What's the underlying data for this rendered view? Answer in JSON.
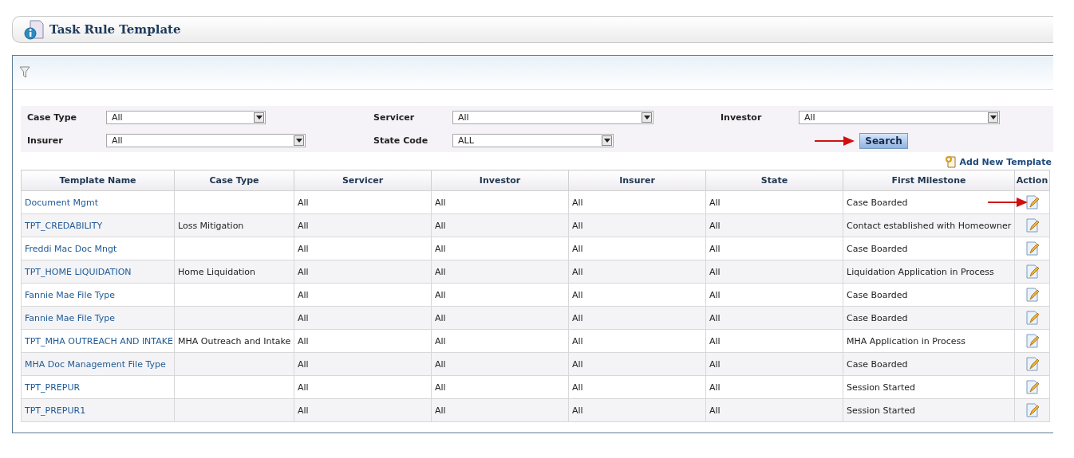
{
  "page": {
    "title": "Task Rule Template"
  },
  "filters": [
    {
      "label": "Case Type",
      "value": "All"
    },
    {
      "label": "Servicer",
      "value": "All"
    },
    {
      "label": "Investor",
      "value": "All"
    },
    {
      "label": "Insurer",
      "value": "All"
    },
    {
      "label": "State Code",
      "value": "ALL"
    }
  ],
  "search_button": "Search",
  "add_link": "Add New Template",
  "table": {
    "columns": [
      "Template Name",
      "Case Type",
      "Servicer",
      "Investor",
      "Insurer",
      "State",
      "First Milestone",
      "Action"
    ],
    "rows": [
      {
        "name": "Document Mgmt",
        "case_type": "",
        "servicer": "All",
        "investor": "All",
        "insurer": "All",
        "state": "All",
        "milestone": "Case Boarded"
      },
      {
        "name": "TPT_CREDABILITY",
        "case_type": "Loss Mitigation",
        "servicer": "All",
        "investor": "All",
        "insurer": "All",
        "state": "All",
        "milestone": "Contact established with Homeowner"
      },
      {
        "name": "Freddi Mac Doc Mngt",
        "case_type": "",
        "servicer": "All",
        "investor": "All",
        "insurer": "All",
        "state": "All",
        "milestone": "Case Boarded"
      },
      {
        "name": "TPT_HOME LIQUIDATION",
        "case_type": "Home Liquidation",
        "servicer": "All",
        "investor": "All",
        "insurer": "All",
        "state": "All",
        "milestone": "Liquidation Application in Process"
      },
      {
        "name": "Fannie Mae File Type",
        "case_type": "",
        "servicer": "All",
        "investor": "All",
        "insurer": "All",
        "state": "All",
        "milestone": "Case Boarded"
      },
      {
        "name": "Fannie Mae File Type",
        "case_type": "",
        "servicer": "All",
        "investor": "All",
        "insurer": "All",
        "state": "All",
        "milestone": "Case Boarded"
      },
      {
        "name": "TPT_MHA OUTREACH AND INTAKE",
        "case_type": "MHA Outreach and Intake",
        "servicer": "All",
        "investor": "All",
        "insurer": "All",
        "state": "All",
        "milestone": "MHA Application in Process"
      },
      {
        "name": "MHA Doc Management File Type",
        "case_type": "",
        "servicer": "All",
        "investor": "All",
        "insurer": "All",
        "state": "All",
        "milestone": "Case Boarded"
      },
      {
        "name": "TPT_PREPUR",
        "case_type": "",
        "servicer": "All",
        "investor": "All",
        "insurer": "All",
        "state": "All",
        "milestone": "Session Started"
      },
      {
        "name": "TPT_PREPUR1",
        "case_type": "",
        "servicer": "All",
        "investor": "All",
        "insurer": "All",
        "state": "All",
        "milestone": "Session Started"
      }
    ]
  }
}
